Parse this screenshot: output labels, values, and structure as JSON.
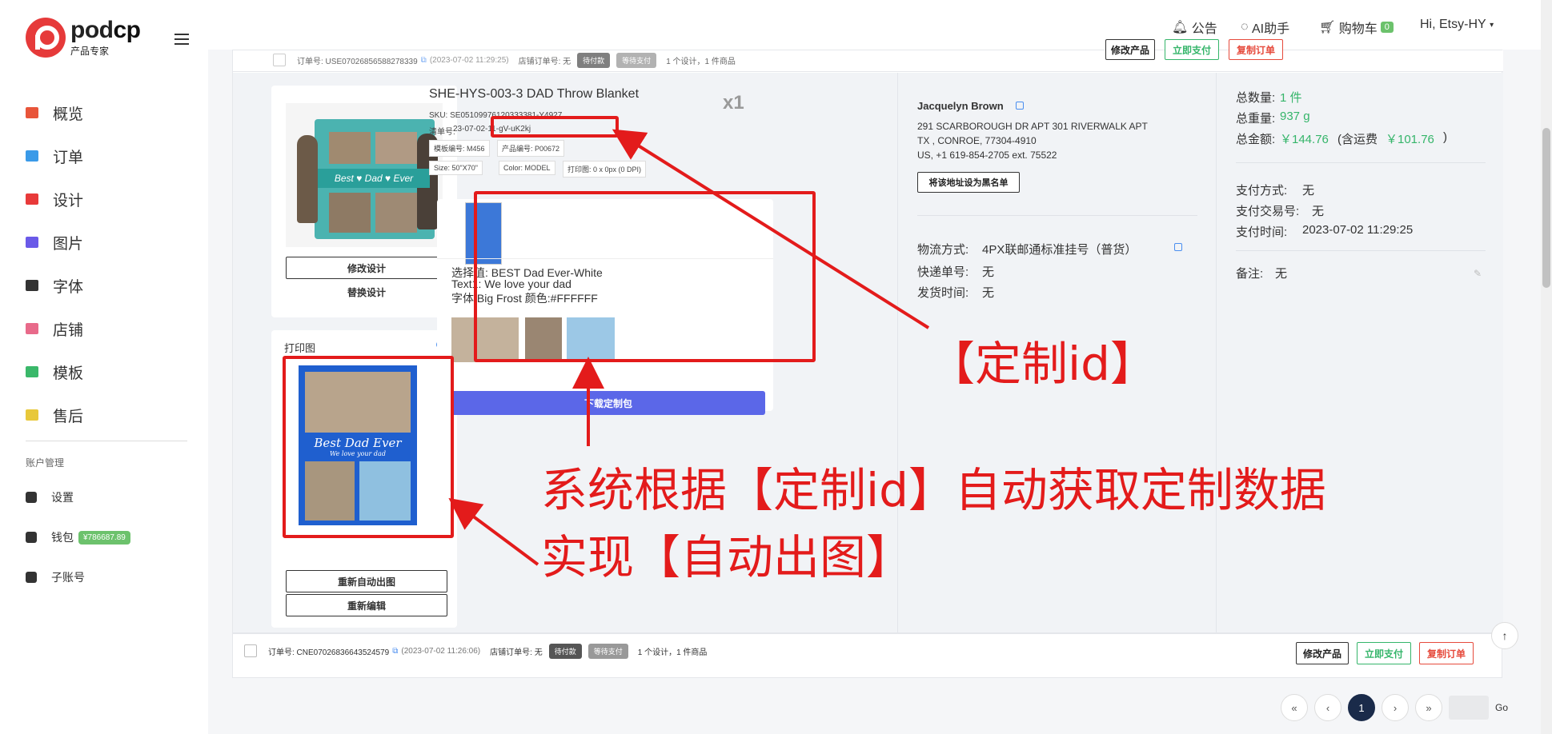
{
  "brand": {
    "name_light": "pod",
    "name_bold": "cp",
    "subtitle": "产品专家",
    "color": "#e63a3a"
  },
  "sidebar": {
    "items": [
      {
        "label": "概览",
        "icon": "dashboard-icon",
        "color": "#e8553a"
      },
      {
        "label": "订单",
        "icon": "list-icon",
        "color": "#3a9ae8"
      },
      {
        "label": "设计",
        "icon": "shirt-icon",
        "color": "#e83a3a"
      },
      {
        "label": "图片",
        "icon": "image-icon",
        "color": "#6a5ae8"
      },
      {
        "label": "字体",
        "icon": "font-icon",
        "color": "#333333"
      },
      {
        "label": "店铺",
        "icon": "store-icon",
        "color": "#e86a8a"
      },
      {
        "label": "模板",
        "icon": "template-icon",
        "color": "#3ab86a"
      },
      {
        "label": "售后",
        "icon": "chat-icon",
        "color": "#e8c83a"
      }
    ],
    "account_section": "账户管理",
    "account_items": [
      {
        "label": "设置",
        "icon": "user-settings-icon"
      },
      {
        "label": "钱包",
        "icon": "wallet-icon",
        "badge": "¥786687.89"
      },
      {
        "label": "子账号",
        "icon": "sub-account-icon"
      }
    ]
  },
  "topbar": {
    "announcement": "公告",
    "ai": "AI助手",
    "cart": "购物车",
    "cart_count": "0",
    "greeting": "Hi, Etsy-HY"
  },
  "order1": {
    "order_no": "订单号: USE07026856588278339",
    "time": "(2023-07-02 11:29:25)",
    "store_order": "店铺订单号: 无",
    "tag_unpaid": "待付款",
    "tag_pending": "等待支付",
    "summary": "1 个设计，1 件商品",
    "btn_edit": "修改产品",
    "btn_pay": "立即支付",
    "btn_copy": "复制订单"
  },
  "product": {
    "title": "SHE-HYS-003-3 DAD Throw Blanket",
    "qty": "x1",
    "sku": "SKU: SE05109976120333381-Y4927",
    "list_no_label": "清单号:",
    "list_no": "23-07-02-11-gV-uK2kj",
    "template_no": "模板编号: M456",
    "product_no": "产品编号: P00672",
    "size": "Size: 50\"X70\"",
    "color": "Color: MODEL",
    "print": "打印图: 0 x 0px (0 DPI)",
    "btn_edit_design": "修改设计",
    "btn_replace_design": "替换设计",
    "print_title": "打印图",
    "btn_regen": "重新自动出图",
    "btn_reedit": "重新编辑",
    "print_line1": "Best Dad Ever",
    "print_line2": "We love your dad"
  },
  "custom": {
    "choice": "选择值: BEST Dad Ever-White",
    "text1": "Text1:   We love your dad",
    "font": "字体:Big Frost   颜色:#FFFFFF",
    "download": "下载定制包"
  },
  "address": {
    "name": "Jacquelyn Brown",
    "line1": "291 SCARBOROUGH DR APT 301 RIVERWALK APT",
    "line2": "TX , CONROE, 77304-4910",
    "line3": "US, +1 619-854-2705 ext. 75522",
    "blacklist_btn": "将该地址设为黑名单",
    "shipping_label": "物流方式:",
    "shipping_value": "4PX联邮通标准挂号（普货）",
    "tracking_label": "快递单号:",
    "tracking_value": "无",
    "ship_time_label": "发货时间:",
    "ship_time_value": "无"
  },
  "totals": {
    "qty_label": "总数量:",
    "qty_value": "1 件",
    "weight_label": "总重量:",
    "weight_value": "937 g",
    "amount_label": "总金额:",
    "amount_value": "￥144.76",
    "ship_fee_label": "(含运费",
    "ship_fee_value": "￥101.76",
    "ship_fee_close": ")",
    "pay_method_label": "支付方式:",
    "pay_method_value": "无",
    "pay_tx_label": "支付交易号:",
    "pay_tx_value": "无",
    "pay_time_label": "支付时间:",
    "pay_time_value": "2023-07-02 11:29:25",
    "note_label": "备注:",
    "note_value": "无"
  },
  "order2": {
    "order_no": "订单号: CNE07026836643524579",
    "time": "(2023-07-02 11:26:06)",
    "store_order": "店铺订单号: 无",
    "tag_unpaid": "待付款",
    "tag_pending": "等待支付",
    "summary": "1 个设计，1 件商品",
    "btn_edit": "修改产品",
    "btn_pay": "立即支付",
    "btn_copy": "复制订单"
  },
  "annotations": {
    "custom_id": "【定制id】",
    "line1": "系统根据【定制id】自动获取定制数据",
    "line2": "实现【自动出图】",
    "color": "#e31b1b"
  },
  "pagination": {
    "first": "«",
    "prev": "‹",
    "current": "1",
    "next": "›",
    "last": "»",
    "go": "Go"
  }
}
